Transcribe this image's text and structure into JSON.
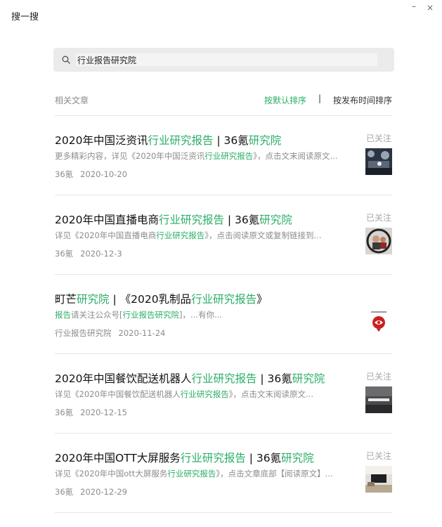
{
  "window": {
    "title": "搜一搜",
    "minimize_glyph": "–",
    "close_glyph": "×"
  },
  "search": {
    "value": "行业报告研究院",
    "icon": "search-icon"
  },
  "toolbar": {
    "related_label": "相关文章",
    "sort_default": "按默认排序",
    "separator": "|",
    "sort_time": "按发布时间排序"
  },
  "colors": {
    "highlight": "#2aae67",
    "muted": "#8c8c8c",
    "title": "#111111"
  },
  "results": [
    {
      "title": {
        "a": "2020年中国泛资讯",
        "b": "行业研究报告",
        "c": " | 36氪",
        "d": "研究院"
      },
      "desc": {
        "a": "更多精彩内容，详见《2020年中国泛资讯",
        "b": "行业研究报告",
        "c": "》，点击文末阅读原文..."
      },
      "source": "36氪",
      "date": "2020-10-20",
      "followed": "已关注"
    },
    {
      "title": {
        "a": "2020年中国直播电商",
        "b": "行业研究报告",
        "c": " | 36氪",
        "d": "研究院"
      },
      "desc": {
        "a": "详见《2020年中国直播电商",
        "b": "行业研究报告",
        "c": "》，点击阅读原文或复制链接到..."
      },
      "source": "36氪",
      "date": "2020-12-3",
      "followed": "已关注"
    },
    {
      "title": {
        "a": "町芒",
        "b": "研究院",
        "c": " | 《2020乳制品",
        "d": "行业研究报告",
        "e": "》"
      },
      "desc": {
        "a": "报告",
        "b": "请关注公众号[",
        "c": "行业报告研究院",
        "d": "]，...有你..."
      },
      "source": "行业报告研究院",
      "date": "2020-11-24"
    },
    {
      "title": {
        "a": "2020年中国餐饮配送机器人",
        "b": "行业研究报告",
        "c": " | 36氪",
        "d": "研究院"
      },
      "desc": {
        "a": "详见《2020年中国餐饮配送机器人",
        "b": "行业研究报告",
        "c": "》，点击文末阅读原文..."
      },
      "source": "36氪",
      "date": "2020-12-15",
      "followed": "已关注"
    },
    {
      "title": {
        "a": "2020年中国OTT大屏服务",
        "b": "行业研究报告",
        "c": " | 36氪",
        "d": "研究院"
      },
      "desc": {
        "a": "详见《2020年中国ott大屏服务",
        "b": "行业研究报告",
        "c": "》，点击文章底部【阅读原文】..."
      },
      "source": "36氪",
      "date": "2020-12-29",
      "followed": "已关注"
    }
  ]
}
